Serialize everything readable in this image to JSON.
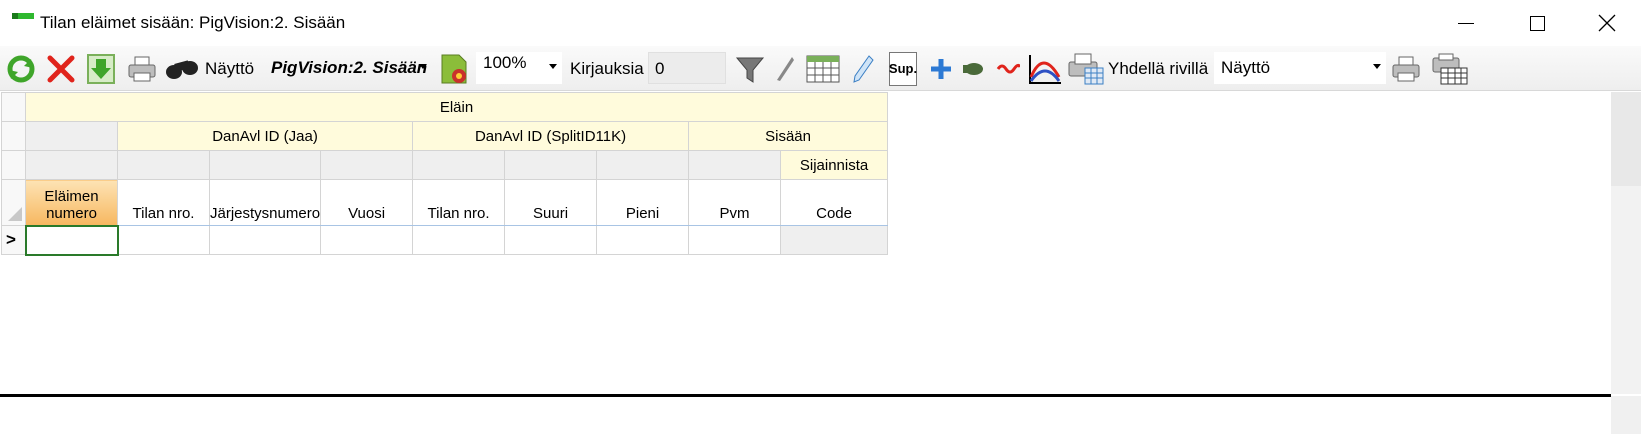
{
  "window": {
    "title": "Tilan eläimet sisään: PigVision:2. Sisään"
  },
  "toolbar": {
    "icons": [
      "refresh-icon",
      "delete-icon",
      "download-icon",
      "print-icon",
      "binoculars-icon",
      "report-settings-icon",
      "filter-icon",
      "wrench-icon",
      "calendar-grid-icon",
      "pen-icon",
      "sup-icon",
      "add-icon",
      "animal-icon",
      "pig-icon",
      "curve-chart-icon",
      "print-list-icon",
      "print-icon",
      "print-grid-icon"
    ],
    "display_label": "Näyttö",
    "view_combo": "PigVision:2. Sisään",
    "zoom": "100%",
    "records_label": "Kirjauksia",
    "records_value": "0",
    "sup_label": "Sup.",
    "single_row_label": "Yhdellä rivillä",
    "display_combo": "Näyttö"
  },
  "grid": {
    "band_top": "Eläin",
    "bands": [
      "DanAvl ID (Jaa)",
      "DanAvl ID (SplitID11K)",
      "Sisään"
    ],
    "sub_band": "Sijainnista",
    "columns": [
      "Eläimen numero",
      "Tilan nro.",
      "Järjestysnumero",
      "Vuosi",
      "Tilan nro.",
      "Suuri",
      "Pieni",
      "Pvm",
      "Code"
    ],
    "new_row_marker": ">"
  }
}
